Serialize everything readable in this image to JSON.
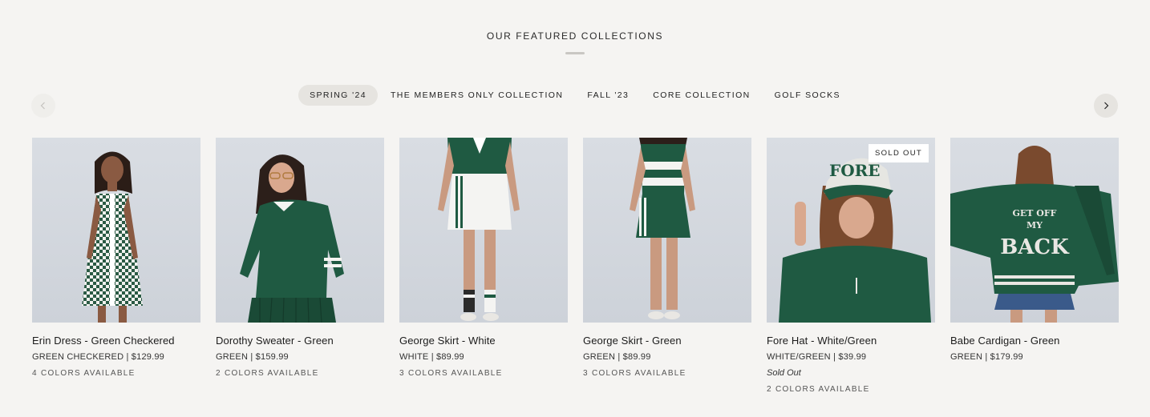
{
  "section": {
    "title": "OUR FEATURED COLLECTIONS"
  },
  "tabs": [
    {
      "label": "SPRING '24",
      "active": true
    },
    {
      "label": "THE MEMBERS ONLY COLLECTION",
      "active": false
    },
    {
      "label": "FALL '23",
      "active": false
    },
    {
      "label": "CORE COLLECTION",
      "active": false
    },
    {
      "label": "GOLF SOCKS",
      "active": false
    }
  ],
  "nav": {
    "prev_icon": "chevron-left-icon",
    "next_icon": "chevron-right-icon"
  },
  "products": [
    {
      "name": "Erin Dress - Green Checkered",
      "variant": "GREEN CHECKERED | $129.99",
      "colors": "4 COLORS AVAILABLE"
    },
    {
      "name": "Dorothy Sweater - Green",
      "variant": "GREEN | $159.99",
      "colors": "2 COLORS AVAILABLE"
    },
    {
      "name": "George Skirt - White",
      "variant": "WHITE | $89.99",
      "colors": "3 COLORS AVAILABLE"
    },
    {
      "name": "George Skirt - Green",
      "variant": "GREEN | $89.99",
      "colors": "3 COLORS AVAILABLE"
    },
    {
      "name": "Fore Hat - White/Green",
      "variant": "WHITE/GREEN | $39.99",
      "sold_out_text": "Sold Out",
      "badge": "SOLD OUT",
      "colors": "2 COLORS AVAILABLE"
    },
    {
      "name": "Babe Cardigan - Green",
      "variant": "GREEN | $179.99"
    }
  ],
  "image_text": {
    "hat": "FORE",
    "cardigan_line1": "GET OFF",
    "cardigan_line2": "MY",
    "cardigan_line3": "BACK"
  },
  "colors": {
    "green": "#1f4d3a",
    "background": "#f5f4f2",
    "photo_bg": "#d3d8df"
  }
}
